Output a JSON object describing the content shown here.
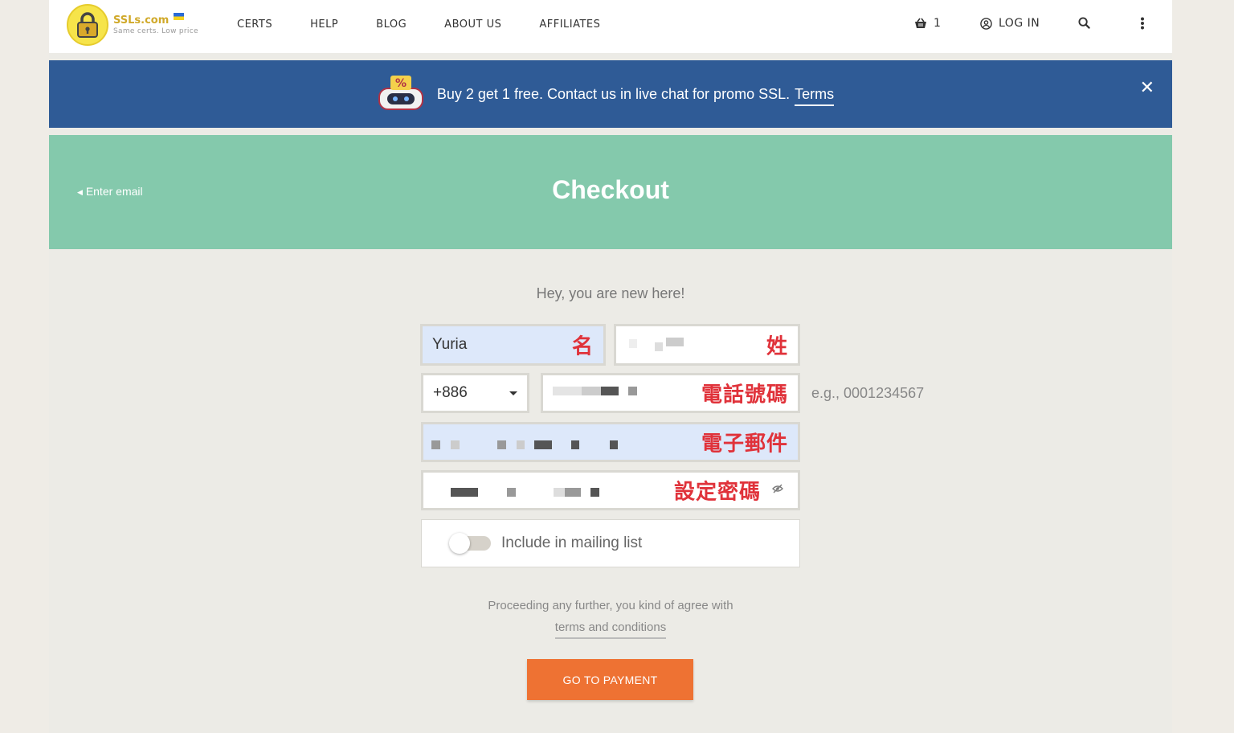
{
  "header": {
    "logo_name": "SSLs.com",
    "logo_tagline": "Same certs. Low price",
    "nav": [
      "CERTS",
      "HELP",
      "BLOG",
      "ABOUT US",
      "AFFILIATES"
    ],
    "cart_count": "1",
    "login_label": "LOG IN"
  },
  "promo": {
    "text": "Buy 2 get 1 free. Contact us in live chat for promo SSL.",
    "link": "Terms",
    "close": "✕"
  },
  "hero": {
    "back_link": "Enter email",
    "title": "Checkout"
  },
  "form": {
    "greeting": "Hey, you are new here!",
    "first_name_value": "Yuria",
    "first_name_annotation": "名",
    "last_name_annotation": "姓",
    "phone_code": "+886",
    "phone_annotation": "電話號碼",
    "phone_hint": "e.g., 0001234567",
    "email_annotation": "電子郵件",
    "password_annotation": "設定密碼",
    "mailing_label": "Include in mailing list",
    "legal_text": "Proceeding any further, you kind of agree with",
    "legal_link": "terms and conditions",
    "submit_label": "GO TO PAYMENT"
  },
  "colors": {
    "promo_bg": "#2f5b96",
    "hero_bg": "#84c9ac",
    "button_bg": "#ee7233",
    "annotation": "#e0323a",
    "autofill_bg": "#dde8fa"
  }
}
